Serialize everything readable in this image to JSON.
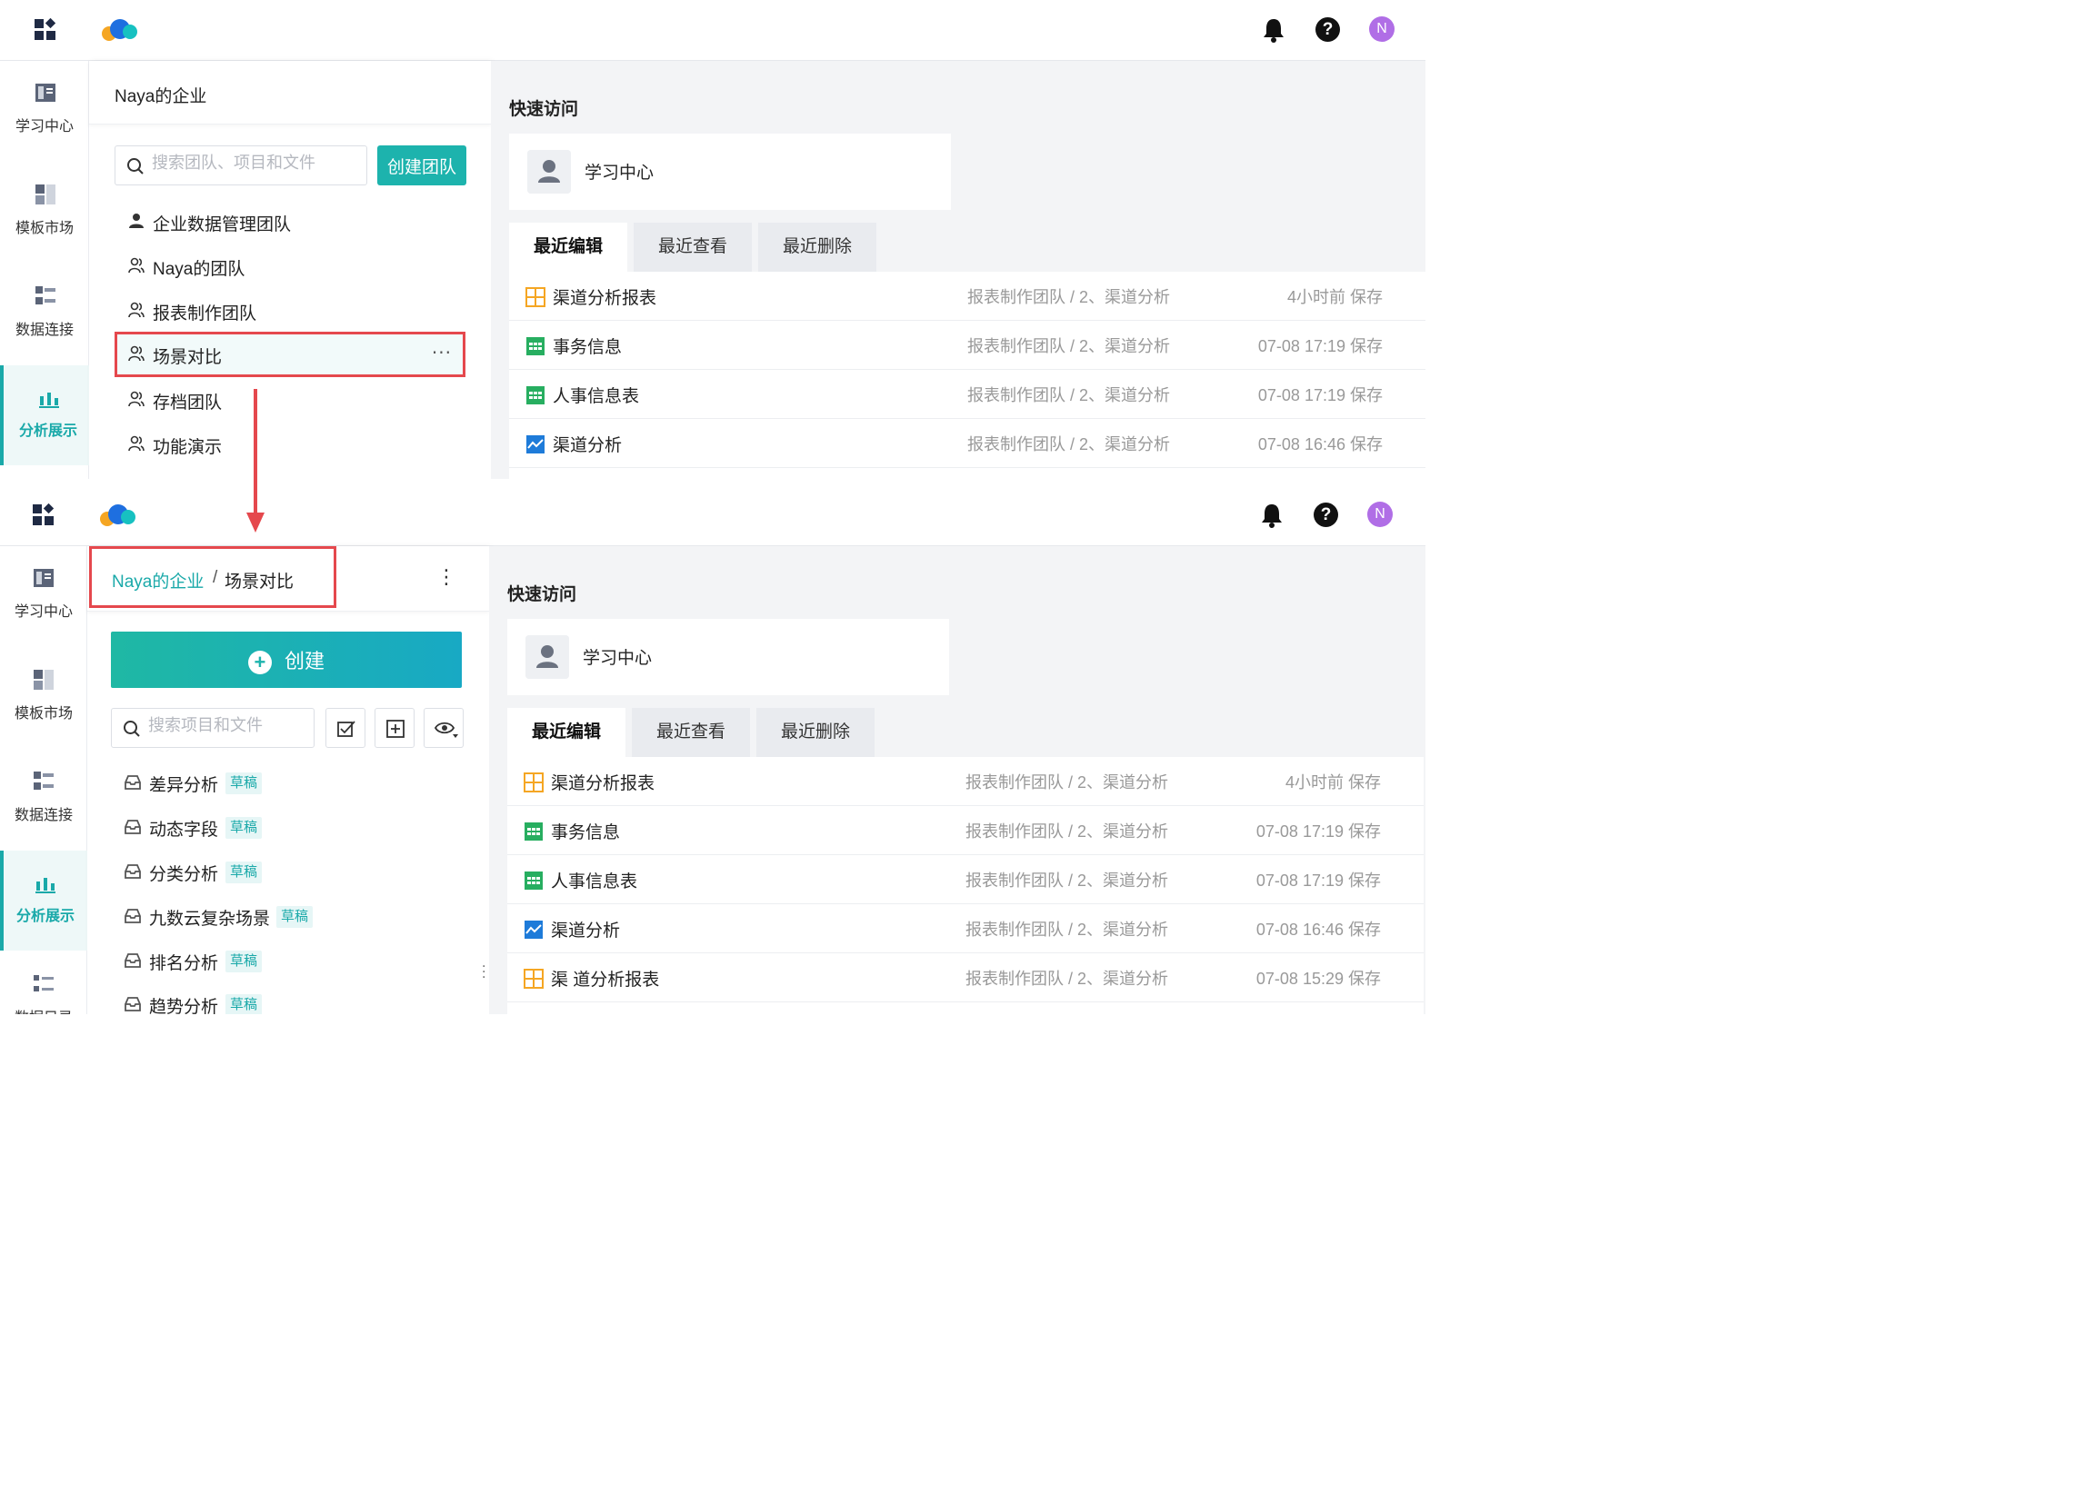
{
  "header": {
    "avatar_letter": "N",
    "help_glyph": "?",
    "icons": [
      "apps-grid-icon",
      "cloud-logo-icon",
      "bell-icon",
      "help-icon"
    ]
  },
  "sidebar": {
    "items": [
      {
        "label": "学习中心",
        "icon": "book-icon",
        "active": false
      },
      {
        "label": "模板市场",
        "icon": "template-icon",
        "active": false
      },
      {
        "label": "数据连接",
        "icon": "data-connect-icon",
        "active": false
      },
      {
        "label": "分析展示",
        "icon": "chart-icon",
        "active": true
      }
    ],
    "extra_label": "数据目录"
  },
  "team_panel": {
    "org_title": "Naya的企业",
    "search_placeholder": "搜索团队、项目和文件",
    "create_team_label": "创建团队",
    "teams": [
      {
        "label": "企业数据管理团队",
        "selected": false
      },
      {
        "label": "Naya的团队",
        "selected": false
      },
      {
        "label": "报表制作团队",
        "selected": false
      },
      {
        "label": "场景对比",
        "selected": true
      },
      {
        "label": "存档团队",
        "selected": false
      },
      {
        "label": "功能演示",
        "selected": false
      }
    ]
  },
  "project_panel": {
    "breadcrumb_org": "Naya的企业",
    "breadcrumb_sep": "/",
    "breadcrumb_current": "场景对比",
    "create_label": "创建",
    "search_placeholder": "搜索项目和文件",
    "draft_label": "草稿",
    "projects": [
      "差异分析",
      "动态字段",
      "分类分析",
      "九数云复杂场景",
      "排名分析",
      "趋势分析"
    ]
  },
  "main": {
    "quick_access_title": "快速访问",
    "quick_access_item": "学习中心",
    "tabs": [
      "最近编辑",
      "最近查看",
      "最近删除"
    ],
    "active_tab": 0,
    "rows": [
      {
        "name": "渠道分析报表",
        "path": "报表制作团队 / 2、渠道分析",
        "time": "4小时前 保存",
        "icon": "dashboard-icon",
        "color": "#f5a623"
      },
      {
        "name": "事务信息",
        "path": "报表制作团队 / 2、渠道分析",
        "time": "07-08 17:19 保存",
        "icon": "table-icon",
        "color": "#27ae60"
      },
      {
        "name": "人事信息表",
        "path": "报表制作团队 / 2、渠道分析",
        "time": "07-08 17:19 保存",
        "icon": "table-icon",
        "color": "#27ae60"
      },
      {
        "name": "渠道分析",
        "path": "报表制作团队 / 2、渠道分析",
        "time": "07-08 16:46 保存",
        "icon": "line-chart-icon",
        "color": "#1e7bd9"
      },
      {
        "name": "渠 道分析报表",
        "path": "报表制作团队 / 2、渠道分析",
        "time": "07-08 15:29 保存",
        "icon": "dashboard-icon",
        "color": "#f5a623"
      }
    ]
  },
  "colors": {
    "accent": "#1aa9a9",
    "highlight_border": "#e5484d",
    "avatar": "#b06ee6"
  }
}
